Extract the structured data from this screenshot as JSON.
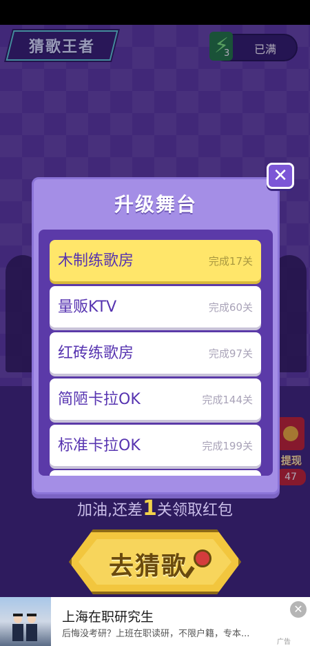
{
  "app": {
    "logo_text": "猜歌王者",
    "energy_count": "3",
    "energy_status": "已满"
  },
  "dialog": {
    "title": "升级舞台",
    "items": [
      {
        "name": "木制练歌房",
        "requirement": "完成17关",
        "active": true
      },
      {
        "name": "量贩KTV",
        "requirement": "完成60关",
        "active": false
      },
      {
        "name": "红砖练歌房",
        "requirement": "完成97关",
        "active": false
      },
      {
        "name": "简陋卡拉OK",
        "requirement": "完成144关",
        "active": false
      },
      {
        "name": "标准卡拉OK",
        "requirement": "完成199关",
        "active": false
      }
    ],
    "close_icon": "close-icon"
  },
  "red_packet": {
    "label": "提现",
    "count": "47"
  },
  "progress": {
    "prefix": "加油,还差",
    "number": "1",
    "unit_suffix": "关",
    "suffix": "领取红包"
  },
  "main_button": {
    "label": "去猜歌"
  },
  "ad": {
    "title": "上海在职研究生",
    "description": "后悔没考研？上班在职读研，不限户籍，专本...",
    "tag": "广告"
  },
  "colors": {
    "background": "#5a3a9f",
    "dialog": "#a48ee6",
    "list_panel": "#5b3aa8",
    "active_item": "#ffe66a",
    "item_text": "#5633b0",
    "button": "#f2c63e"
  }
}
